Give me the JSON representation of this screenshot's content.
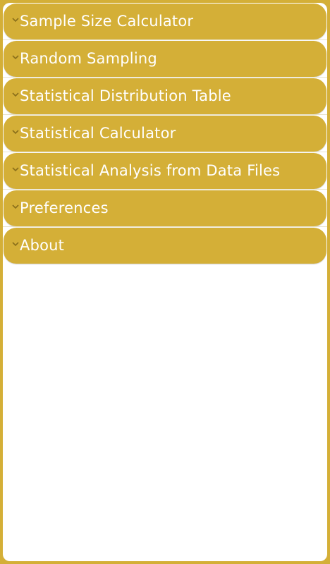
{
  "colors": {
    "accent": "#d4af37",
    "background": "#ffffff",
    "text": "#ffffff",
    "chevron": "#8a6f1b"
  },
  "menu": {
    "items": [
      {
        "label": "Sample Size Calculator",
        "icon": "chevron-down-icon"
      },
      {
        "label": "Random Sampling",
        "icon": "chevron-down-icon"
      },
      {
        "label": "Statistical Distribution Table",
        "icon": "chevron-down-icon"
      },
      {
        "label": "Statistical Calculator",
        "icon": "chevron-down-icon"
      },
      {
        "label": "Statistical Analysis from Data Files",
        "icon": "chevron-down-icon"
      },
      {
        "label": "Preferences",
        "icon": "chevron-down-icon"
      },
      {
        "label": "About",
        "icon": "chevron-down-icon"
      }
    ]
  }
}
